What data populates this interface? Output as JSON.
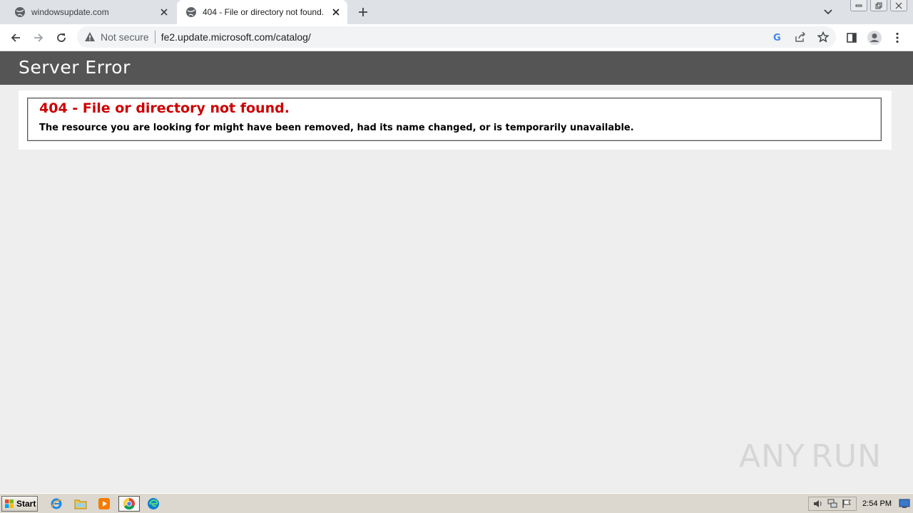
{
  "browser": {
    "tabs": [
      {
        "title": "windowsupdate.com",
        "active": false
      },
      {
        "title": "404 - File or directory not found.",
        "active": true
      }
    ],
    "security_label": "Not secure",
    "url": "fe2.update.microsoft.com/catalog/"
  },
  "page": {
    "header": "Server Error",
    "error_title": "404 - File or directory not found.",
    "error_description": "The resource you are looking for might have been removed, had its name changed, or is temporarily unavailable."
  },
  "watermark": {
    "left": "ANY",
    "right": "RUN"
  },
  "taskbar": {
    "start_label": "Start",
    "clock": "2:54 PM",
    "pinned": [
      "internet-explorer-icon",
      "file-explorer-icon",
      "media-player-icon",
      "chrome-icon",
      "edge-icon"
    ]
  },
  "colors": {
    "header_bg": "#555555",
    "error_red": "#cc0000",
    "page_bg": "#eeeeee"
  }
}
